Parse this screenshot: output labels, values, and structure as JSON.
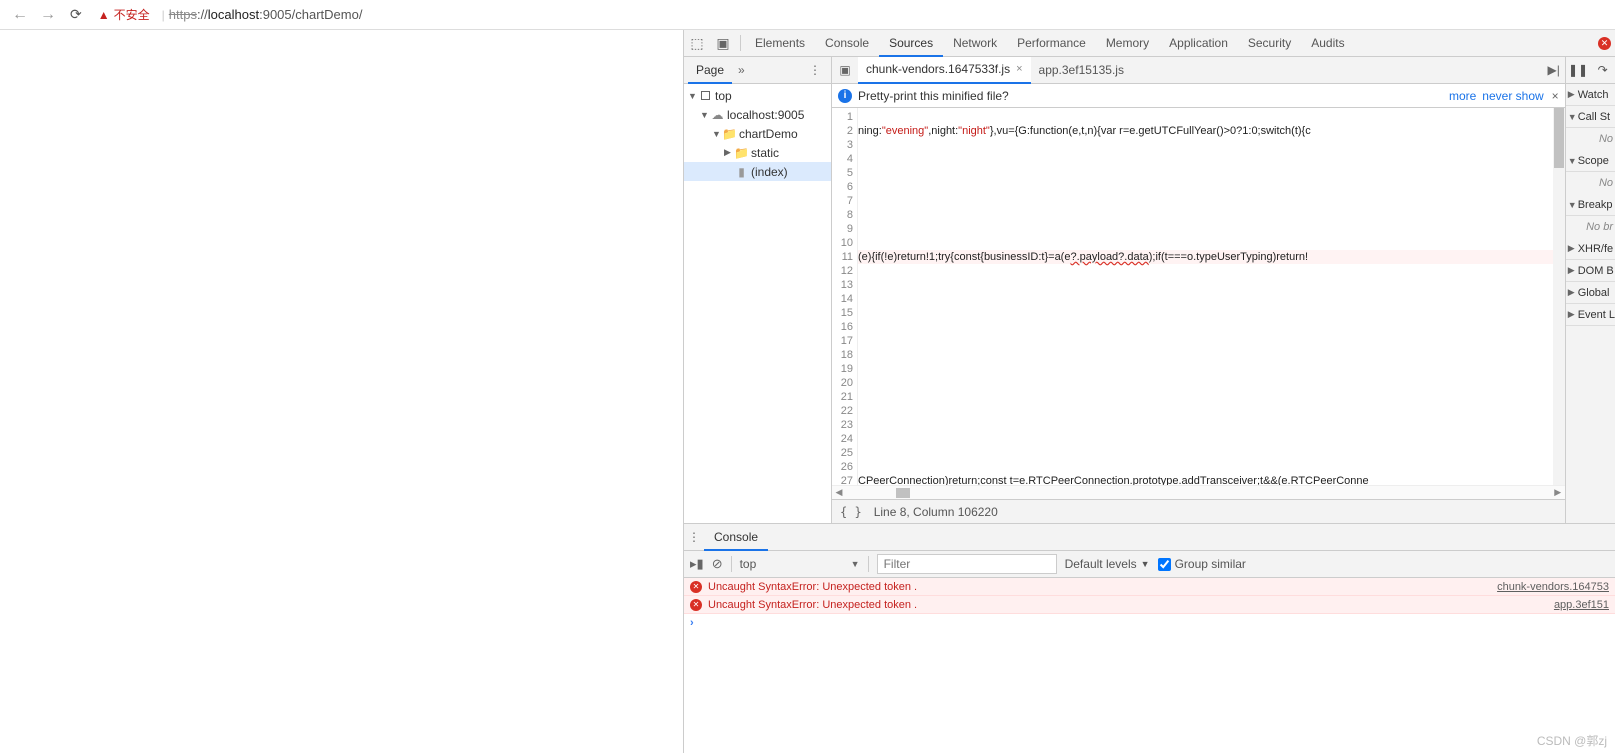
{
  "browser": {
    "security_label": "不安全",
    "url_scheme": "https",
    "url_rest": "://",
    "url_host": "localhost",
    "url_port": ":9005",
    "url_path": "/chartDemo/"
  },
  "devtools": {
    "tabs": [
      "Elements",
      "Console",
      "Sources",
      "Network",
      "Performance",
      "Memory",
      "Application",
      "Security",
      "Audits"
    ],
    "active_tab": "Sources"
  },
  "sources": {
    "left_tab": "Page",
    "tree": {
      "top": "top",
      "host": "localhost:9005",
      "folder": "chartDemo",
      "static": "static",
      "index": "(index)"
    },
    "file_tabs": [
      {
        "name": "chunk-vendors.1647533f.js",
        "active": true,
        "closable": true
      },
      {
        "name": "app.3ef15135.js",
        "active": false,
        "closable": false
      }
    ],
    "pretty_q": "Pretty-print this minified file?",
    "more_link": "more",
    "never_link": "never show",
    "code": {
      "line1_a": "ning:",
      "line1_s1": "\"evening\"",
      "line1_b": ",night:",
      "line1_s2": "\"night\"",
      "line1_c": "},vu={G:function(e,t,n){var r=e.getUTCFullYear()>0?1:0;switch(t){c",
      "line8_a": "(e){if(!e)return!1;try{const{businessID:t}=a(e",
      "line8_w": "?.payload?.data",
      "line8_b": ");if(t===o.typeUserTyping)return!",
      "line22": "CPeerConnection)return;const t=e.RTCPeerConnection.prototype.addTransceiver;t&&(e.RTCPeerConne"
    },
    "status": "Line 8, Column 106220"
  },
  "right": {
    "watch": "Watch",
    "callstack": "Call St",
    "scope": "Scope",
    "breakpoints": "Breakp",
    "xhr": "XHR/fe",
    "dom": "DOM B",
    "global": "Global",
    "event": "Event L",
    "hint_no": "No",
    "hint_nobr": "No br"
  },
  "console": {
    "tab": "Console",
    "context": "top",
    "filter_ph": "Filter",
    "levels": "Default levels",
    "group": "Group similar",
    "errors": [
      {
        "msg": "Uncaught SyntaxError: Unexpected token .",
        "loc": "chunk-vendors.164753"
      },
      {
        "msg": "Uncaught SyntaxError: Unexpected token .",
        "loc": "app.3ef151"
      }
    ]
  },
  "watermark": "CSDN @郭zj"
}
